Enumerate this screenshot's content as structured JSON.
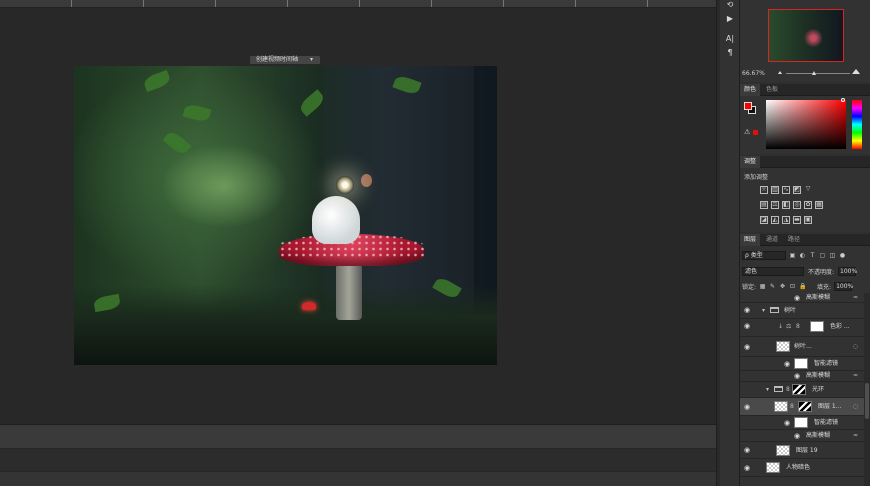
{
  "navigator": {
    "zoom": "66.67%"
  },
  "color_panel": {
    "tabs": [
      "颜色",
      "色板"
    ],
    "foreground": "#ff0000",
    "background": "#111111"
  },
  "adjustments": {
    "tab": "调整",
    "add_label": "添加调整"
  },
  "layers": {
    "tabs": [
      "图层",
      "通道",
      "路径"
    ],
    "filter_kind": "ρ 类型",
    "blend_mode": "滤色",
    "opacity_label": "不透明度:",
    "opacity_value": "100%",
    "lock_label": "锁定:",
    "fill_label": "填充:",
    "fill_value": "100%",
    "rows": [
      {
        "name": "高斯模糊"
      },
      {
        "name": "树叶"
      },
      {
        "name": "色彩 ..."
      },
      {
        "name": "树叶..."
      },
      {
        "name": "智能滤镜"
      },
      {
        "name": "高斯模糊"
      },
      {
        "name": "光环"
      },
      {
        "name": "图层 1..."
      },
      {
        "name": "智能滤镜"
      },
      {
        "name": "高斯模糊"
      },
      {
        "name": "图层 19"
      },
      {
        "name": "人物暗色"
      }
    ]
  },
  "timeline": {
    "button": "创建视频时间轴"
  },
  "colors": {
    "accent": "#d22222",
    "panel": "#323232",
    "workspace": "#282828"
  }
}
